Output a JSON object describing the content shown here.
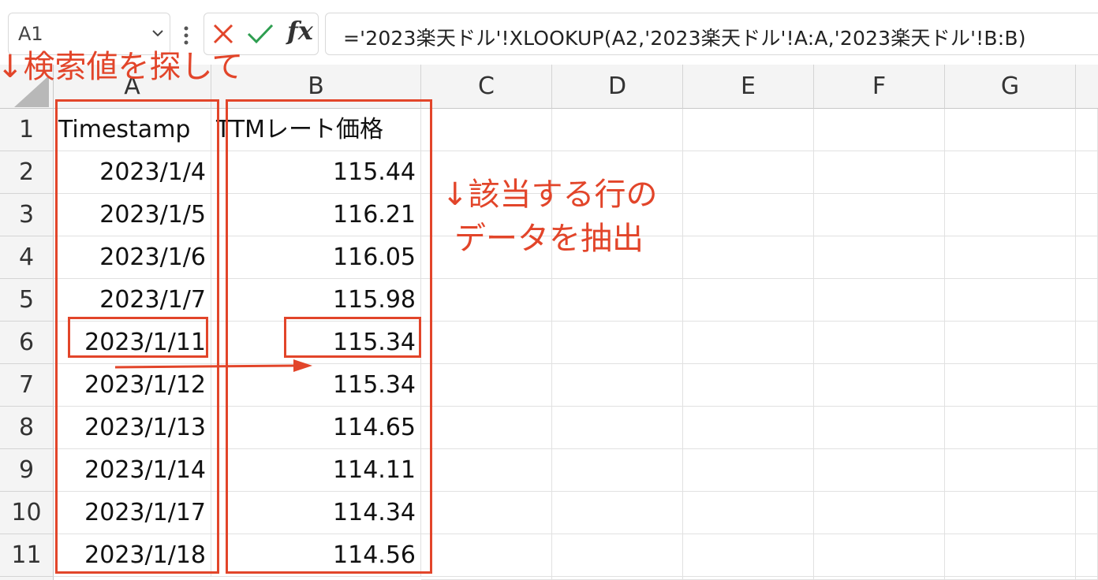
{
  "name_box": {
    "value": "A1"
  },
  "formula_bar": {
    "formula": "='2023楽天ドル'!XLOOKUP(A2,'2023楽天ドル'!A:A,'2023楽天ドル'!B:B)",
    "fx_label": "fx"
  },
  "columns": [
    "A",
    "B",
    "C",
    "D",
    "E",
    "F",
    "G"
  ],
  "rows": [
    "1",
    "2",
    "3",
    "4",
    "5",
    "6",
    "7",
    "8",
    "9",
    "10",
    "11"
  ],
  "header": {
    "timestamp": "Timestamp",
    "price": "TTMレート価格"
  },
  "data_rows": [
    {
      "date": "2023/1/4",
      "price": "115.44"
    },
    {
      "date": "2023/1/5",
      "price": "116.21"
    },
    {
      "date": "2023/1/6",
      "price": "116.05"
    },
    {
      "date": "2023/1/7",
      "price": "115.98"
    },
    {
      "date": "2023/1/11",
      "price": "115.34"
    },
    {
      "date": "2023/1/12",
      "price": "115.34"
    },
    {
      "date": "2023/1/13",
      "price": "114.65"
    },
    {
      "date": "2023/1/14",
      "price": "114.11"
    },
    {
      "date": "2023/1/17",
      "price": "114.34"
    },
    {
      "date": "2023/1/18",
      "price": "114.56"
    }
  ],
  "annotations": {
    "search_note": "↓検索値を探して",
    "extract_note_line1": "↓該当する行の",
    "extract_note_line2": "データを抽出"
  },
  "colors": {
    "annotation": "#e2452a",
    "header_bg": "#f4f4f4",
    "gridline": "#e1e1e1"
  },
  "icons": [
    "chevron-down-icon",
    "more-vert-icon",
    "cancel-icon",
    "check-icon",
    "fx-icon",
    "arrow-right-icon"
  ]
}
